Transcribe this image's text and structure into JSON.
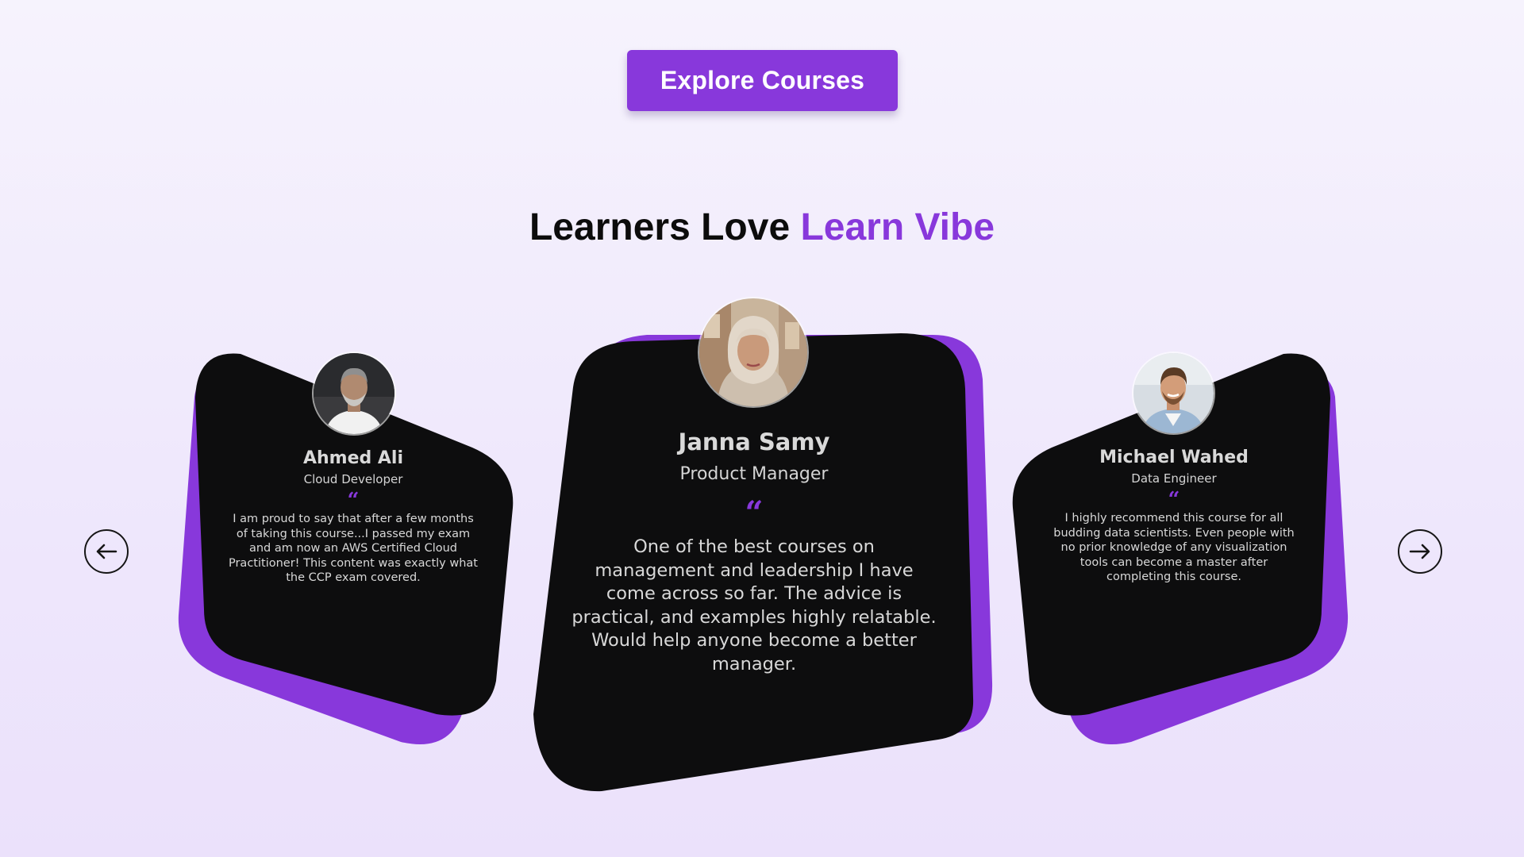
{
  "cta": {
    "label": "Explore Courses"
  },
  "heading": {
    "prefix": "Learners Love ",
    "brand": "Learn Vibe"
  },
  "colors": {
    "accent": "#8838db",
    "card": "#0d0d0e",
    "background": "#f2edfc"
  },
  "nav": {
    "prev_icon": "arrow-left-icon",
    "next_icon": "arrow-right-icon"
  },
  "testimonials": [
    {
      "name": "Ahmed Ali",
      "role": "Cloud Developer",
      "quote_mark": "“",
      "text": "I am proud to say that after a few months of taking this course...I passed my exam and am now an AWS Certified Cloud Practitioner! This content was exactly what the CCP exam covered."
    },
    {
      "name": "Janna Samy",
      "role": "Product Manager",
      "quote_mark": "“",
      "text": "One of the best courses on management and leadership I have come across so far. The advice is practical, and examples highly relatable. Would help anyone become a better manager."
    },
    {
      "name": "Michael Wahed",
      "role": "Data Engineer",
      "quote_mark": "“",
      "text": "I highly recommend this course for all budding data scientists. Even people with no prior knowledge of any visualization tools can become a master after completing this course."
    }
  ]
}
